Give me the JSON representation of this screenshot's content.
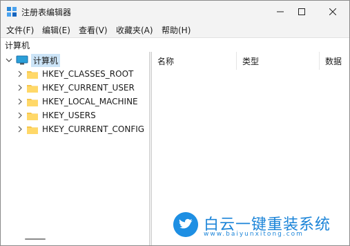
{
  "window": {
    "title": "注册表编辑器"
  },
  "menu": [
    "文件(F)",
    "编辑(E)",
    "查看(V)",
    "收藏夹(A)",
    "帮助(H)"
  ],
  "address": "计算机",
  "tree": {
    "root": "计算机",
    "children": [
      "HKEY_CLASSES_ROOT",
      "HKEY_CURRENT_USER",
      "HKEY_LOCAL_MACHINE",
      "HKEY_USERS",
      "HKEY_CURRENT_CONFIG"
    ]
  },
  "columns": [
    "名称",
    "类型",
    "数据"
  ],
  "watermark": {
    "text": "白云一键重装系统",
    "url": "www.baiyunxitong.com"
  },
  "colors": {
    "folder": "#f6c64b",
    "accent": "#1b84d8",
    "selection": "#cce4f7"
  },
  "icons": {
    "app": "regedit-icon",
    "computer": "computer-icon",
    "folder": "folder-icon"
  }
}
